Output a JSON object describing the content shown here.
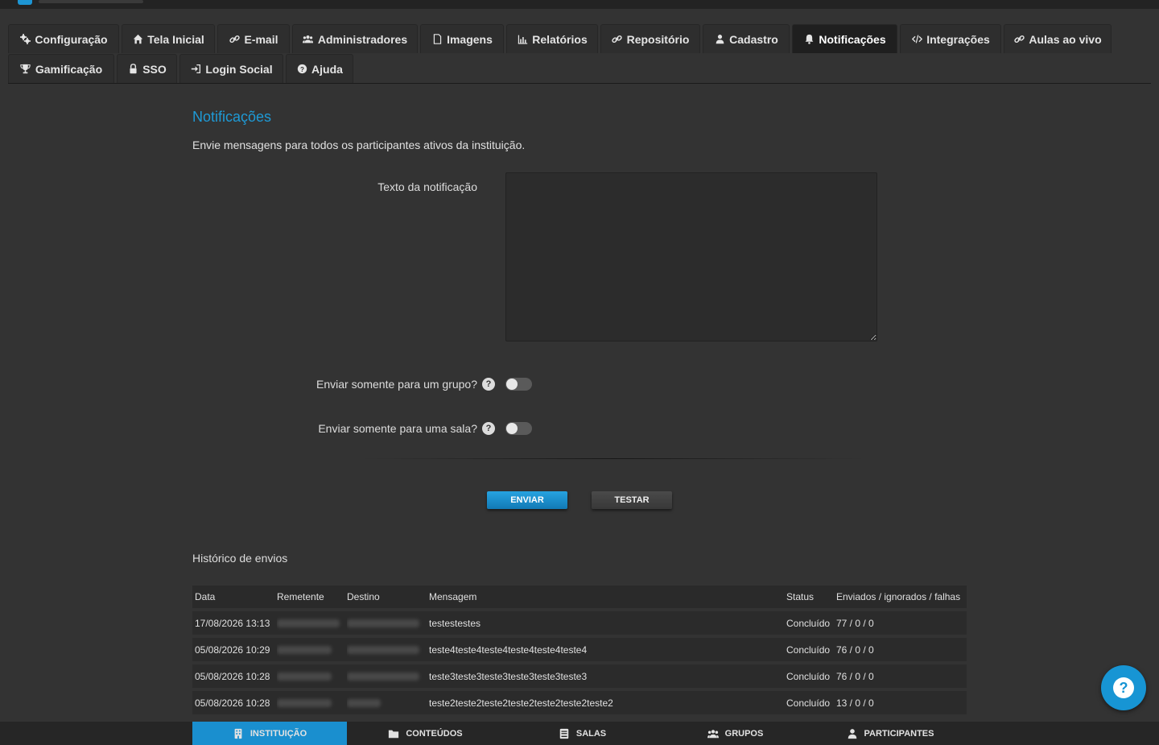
{
  "tabs": [
    {
      "label": "Configuração",
      "icon": "gears-icon"
    },
    {
      "label": "Tela Inicial",
      "icon": "home-icon"
    },
    {
      "label": "E-mail",
      "icon": "link-icon"
    },
    {
      "label": "Administradores",
      "icon": "users-icon"
    },
    {
      "label": "Imagens",
      "icon": "file-icon"
    },
    {
      "label": "Relatórios",
      "icon": "bar-chart-icon"
    },
    {
      "label": "Repositório",
      "icon": "link-icon"
    },
    {
      "label": "Cadastro",
      "icon": "user-icon"
    },
    {
      "label": "Notificações",
      "icon": "bell-icon",
      "active": true
    },
    {
      "label": "Integrações",
      "icon": "code-icon"
    },
    {
      "label": "Aulas ao vivo",
      "icon": "link-icon"
    },
    {
      "label": "Gamificação",
      "icon": "trophy-icon"
    },
    {
      "label": "SSO",
      "icon": "lock-icon"
    },
    {
      "label": "Login Social",
      "icon": "sign-in-icon"
    },
    {
      "label": "Ajuda",
      "icon": "question-circle-icon"
    }
  ],
  "page": {
    "title": "Notificações",
    "subtitle": "Envie mensagens para todos os participantes ativos da instituição."
  },
  "form": {
    "text_label": "Texto da notificação",
    "text_value": "",
    "group_label": "Enviar somente para um grupo?",
    "group_enabled": false,
    "room_label": "Enviar somente para uma sala?",
    "room_enabled": false,
    "help_glyph": "?",
    "send_label": "ENVIAR",
    "test_label": "TESTAR"
  },
  "history": {
    "title": "Histórico de envios",
    "columns": [
      "Data",
      "Remetente",
      "Destino",
      "Mensagem",
      "Status",
      "Enviados / ignorados / falhas"
    ],
    "rows": [
      {
        "date": "17/08/2026 13:13",
        "message": "testestestes",
        "status": "Concluído",
        "counts": "77 / 0 / 0"
      },
      {
        "date": "05/08/2026 10:29",
        "message": "teste4teste4teste4teste4teste4teste4",
        "status": "Concluído",
        "counts": "76 / 0 / 0"
      },
      {
        "date": "05/08/2026 10:28",
        "message": "teste3teste3teste3teste3teste3teste3",
        "status": "Concluído",
        "counts": "76 / 0 / 0"
      },
      {
        "date": "05/08/2026 10:28",
        "message": "teste2teste2teste2teste2teste2teste2teste2",
        "status": "Concluído",
        "counts": "13 / 0 / 0"
      }
    ]
  },
  "help_button": {
    "glyph": "?"
  },
  "bottom_nav": [
    {
      "label": "INSTITUIÇÃO",
      "icon": "building-icon",
      "active": true
    },
    {
      "label": "CONTEÚDOS",
      "icon": "folder-icon"
    },
    {
      "label": "SALAS",
      "icon": "book-icon"
    },
    {
      "label": "GRUPOS",
      "icon": "users-icon"
    },
    {
      "label": "PARTICIPANTES",
      "icon": "user-icon"
    }
  ],
  "colors": {
    "accent": "#1e9ad6",
    "background": "#333333",
    "primary_button": "#1a8fcf"
  }
}
